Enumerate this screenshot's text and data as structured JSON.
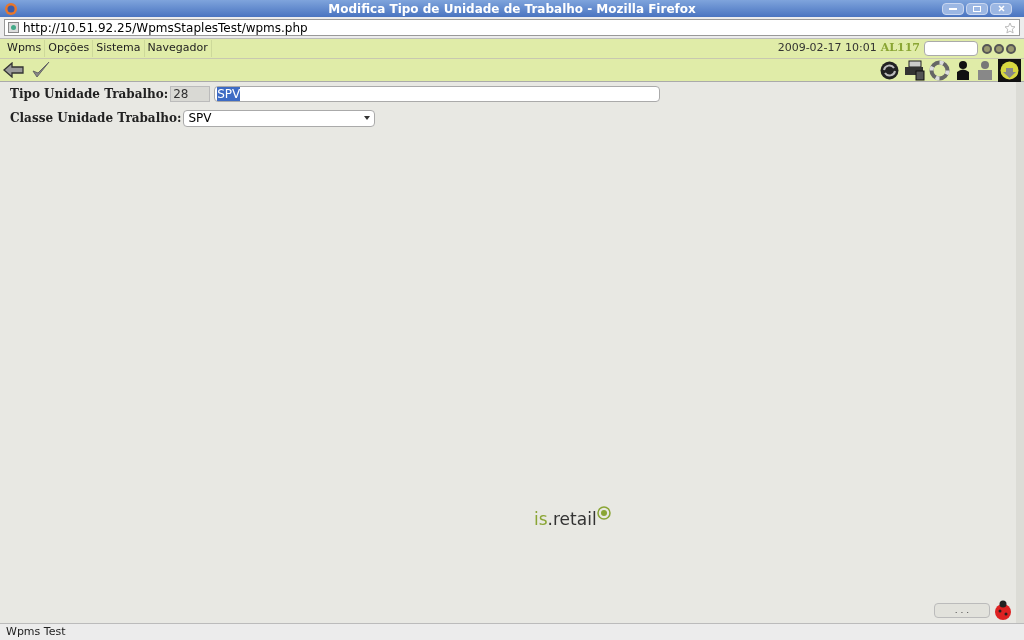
{
  "window": {
    "title": "Modifica Tipo de Unidade de Trabalho - Mozilla Firefox"
  },
  "address_bar": {
    "url": "http://10.51.92.25/WpmsStaplesTest/wpms.php"
  },
  "menu": [
    "Wpms",
    "Opções",
    "Sistema",
    "Navegador"
  ],
  "header": {
    "datetime": "2009-02-17 10:01",
    "user": "AL117"
  },
  "form": {
    "tipo_label": "Tipo Unidade Trabalho:",
    "tipo_code": "28",
    "tipo_name": "SPV",
    "tipo_name_text_selected": true,
    "classe_label": "Classe Unidade Trabalho:",
    "classe_value": "SPV"
  },
  "logo": {
    "part_1": "is",
    "part_2": ".retail"
  },
  "bottom_button": {
    "label": ". . ."
  },
  "status_bar": {
    "text": "Wpms Test"
  }
}
